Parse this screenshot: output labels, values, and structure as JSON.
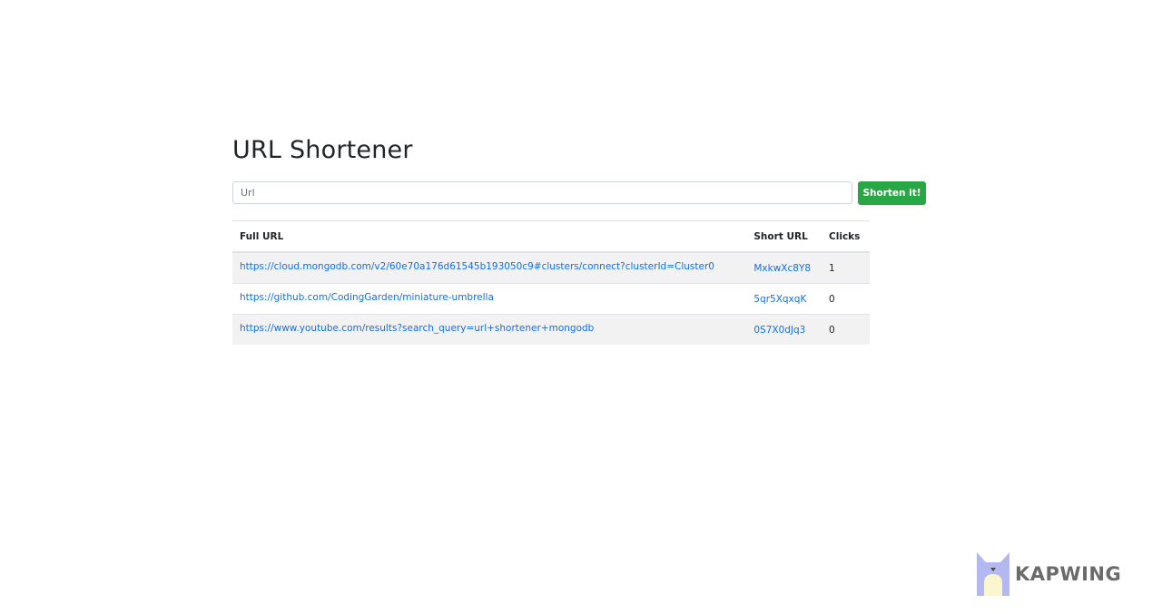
{
  "page": {
    "title": "URL Shortener"
  },
  "form": {
    "placeholder": "Url",
    "value": "",
    "button_label": "Shorten it!"
  },
  "table": {
    "headers": {
      "full_url": "Full URL",
      "short_url": "Short URL",
      "clicks": "Clicks"
    },
    "rows": [
      {
        "full_url": "https://cloud.mongodb.com/v2/60e70a176d61545b193050c9#clusters/connect?clusterId=Cluster0",
        "short_url": "MxkwXc8Y8",
        "clicks": "1"
      },
      {
        "full_url": "https://github.com/CodingGarden/miniature-umbrella",
        "short_url": "5qr5XqxqK",
        "clicks": "0"
      },
      {
        "full_url": "https://www.youtube.com/results?search_query=url+shortener+mongodb",
        "short_url": "0S7X0dJq3",
        "clicks": "0"
      }
    ]
  },
  "watermark": {
    "text": "KAPWING",
    "icon": "kapwing-cat-icon"
  },
  "colors": {
    "button": "#28a745",
    "link": "#0d6efd",
    "stripe": "#f2f2f2",
    "watermark_icon": "#b4b8f0",
    "watermark_text": "#6b6b6b"
  }
}
